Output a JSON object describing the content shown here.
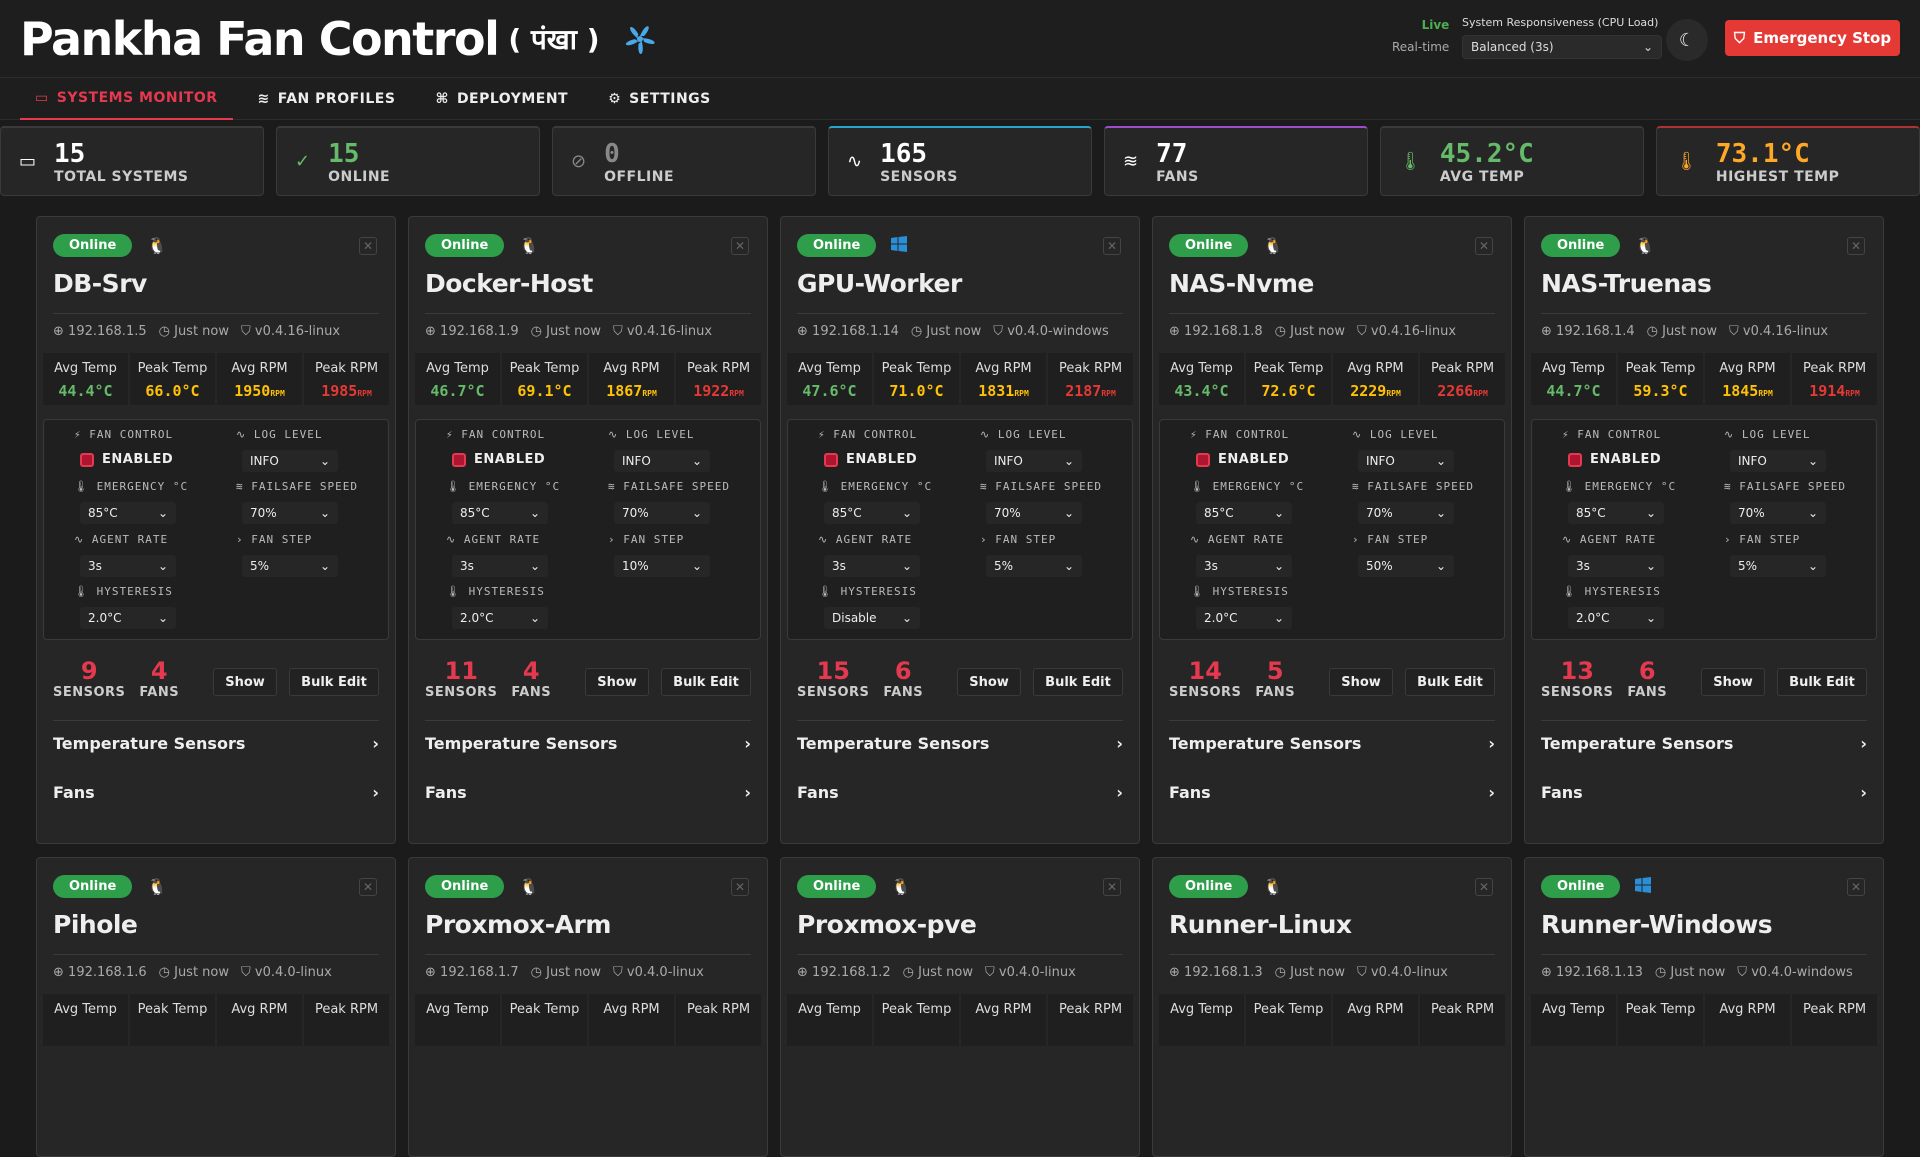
{
  "header": {
    "title": "Pankha Fan Control",
    "subtitle": "( पंखा )",
    "live": "Live",
    "realtime": "Real-time",
    "resp_label": "System Responsiveness (CPU Load)",
    "resp_value": "Balanced (3s)",
    "estop": "Emergency Stop"
  },
  "tabs": [
    "SYSTEMS MONITOR",
    "FAN PROFILES",
    "DEPLOYMENT",
    "SETTINGS"
  ],
  "stats": [
    {
      "n": "15",
      "label": "TOTAL SYSTEMS",
      "color": "#ffffff",
      "border": "#3a3a3a",
      "icon": "monitor-icon"
    },
    {
      "n": "15",
      "label": "ONLINE",
      "color": "#66bb6a",
      "border": "#3a3a3a",
      "icon": "check-circle-icon"
    },
    {
      "n": "0",
      "label": "OFFLINE",
      "color": "#888888",
      "border": "#3a3a3a",
      "icon": "offline-icon"
    },
    {
      "n": "165",
      "label": "SENSORS",
      "color": "#ffffff",
      "border": "#26a6c9",
      "icon": "activity-icon"
    },
    {
      "n": "77",
      "label": "FANS",
      "color": "#ffffff",
      "border": "#9c4dcc",
      "icon": "fan-icon"
    },
    {
      "n": "45.2°C",
      "label": "AVG TEMP",
      "color": "#66bb6a",
      "border": "#3a3a3a",
      "icon": "thermometer-icon"
    },
    {
      "n": "73.1°C",
      "label": "HIGHEST TEMP",
      "color": "#ffa726",
      "border": "#a33",
      "icon": "thermometer-hot-icon"
    }
  ],
  "labels": {
    "online": "Online",
    "avg_temp": "Avg Temp",
    "peak_temp": "Peak Temp",
    "avg_rpm": "Avg RPM",
    "peak_rpm": "Peak RPM",
    "rpm": "RPM",
    "fan_control": "FAN CONTROL",
    "log_level": "LOG LEVEL",
    "enabled": "ENABLED",
    "emergency": "EMERGENCY °C",
    "failsafe": "FAILSAFE SPEED",
    "agent_rate": "AGENT RATE",
    "fan_step": "FAN STEP",
    "hysteresis": "HYSTERESIS",
    "sensors": "SENSORS",
    "fans": "FANS",
    "show": "Show",
    "bulk_edit": "Bulk Edit",
    "temp_sensors": "Temperature Sensors",
    "fans_section": "Fans",
    "just_now": "Just now"
  },
  "systems": [
    {
      "name": "DB-Srv",
      "os": "linux",
      "ip": "192.168.1.5",
      "ver": "v0.4.16-linux",
      "avg_temp": "44.4°C",
      "peak_temp": "66.0°C",
      "avg_rpm": "1950",
      "peak_rpm": "1985",
      "log": "INFO",
      "emerg": "85°C",
      "failsafe": "70%",
      "rate": "3s",
      "step": "5%",
      "hyst": "2.0°C",
      "sensors": "9",
      "fans": "4"
    },
    {
      "name": "Docker-Host",
      "os": "linux",
      "ip": "192.168.1.9",
      "ver": "v0.4.16-linux",
      "avg_temp": "46.7°C",
      "peak_temp": "69.1°C",
      "avg_rpm": "1867",
      "peak_rpm": "1922",
      "log": "INFO",
      "emerg": "85°C",
      "failsafe": "70%",
      "rate": "3s",
      "step": "10%",
      "hyst": "2.0°C",
      "sensors": "11",
      "fans": "4"
    },
    {
      "name": "GPU-Worker",
      "os": "windows",
      "ip": "192.168.1.14",
      "ver": "v0.4.0-windows",
      "avg_temp": "47.6°C",
      "peak_temp": "71.0°C",
      "avg_rpm": "1831",
      "peak_rpm": "2187",
      "log": "INFO",
      "emerg": "85°C",
      "failsafe": "70%",
      "rate": "3s",
      "step": "5%",
      "hyst": "Disable",
      "sensors": "15",
      "fans": "6"
    },
    {
      "name": "NAS-Nvme",
      "os": "linux",
      "ip": "192.168.1.8",
      "ver": "v0.4.16-linux",
      "avg_temp": "43.4°C",
      "peak_temp": "72.6°C",
      "avg_rpm": "2229",
      "peak_rpm": "2266",
      "log": "INFO",
      "emerg": "85°C",
      "failsafe": "70%",
      "rate": "3s",
      "step": "50%",
      "hyst": "2.0°C",
      "sensors": "14",
      "fans": "5"
    },
    {
      "name": "NAS-Truenas",
      "os": "linux",
      "ip": "192.168.1.4",
      "ver": "v0.4.16-linux",
      "avg_temp": "44.7°C",
      "peak_temp": "59.3°C",
      "avg_rpm": "1845",
      "peak_rpm": "1914",
      "log": "INFO",
      "emerg": "85°C",
      "failsafe": "70%",
      "rate": "3s",
      "step": "5%",
      "hyst": "2.0°C",
      "sensors": "13",
      "fans": "6"
    },
    {
      "name": "Pihole",
      "os": "linux",
      "ip": "192.168.1.6",
      "ver": "v0.4.0-linux"
    },
    {
      "name": "Proxmox-Arm",
      "os": "linux",
      "ip": "192.168.1.7",
      "ver": "v0.4.0-linux"
    },
    {
      "name": "Proxmox-pve",
      "os": "linux",
      "ip": "192.168.1.2",
      "ver": "v0.4.0-linux"
    },
    {
      "name": "Runner-Linux",
      "os": "linux",
      "ip": "192.168.1.3",
      "ver": "v0.4.0-linux"
    },
    {
      "name": "Runner-Windows",
      "os": "windows",
      "ip": "192.168.1.13",
      "ver": "v0.4.0-windows"
    }
  ]
}
